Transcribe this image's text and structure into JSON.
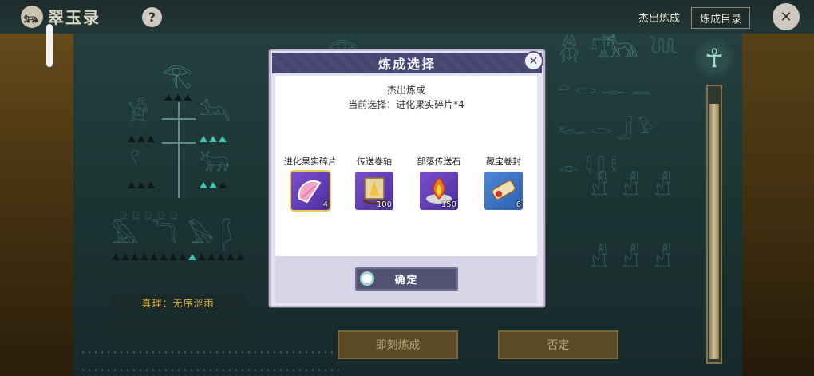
{
  "app": {
    "title": "翠玉录",
    "help_label": "?"
  },
  "top_links": {
    "outstanding": "杰出炼成",
    "catalog": "炼成目录"
  },
  "panel": {
    "truth_label": "真理：无序涩雨"
  },
  "actions": {
    "engrave": "即刻炼成",
    "deny": "否定"
  },
  "modal": {
    "title": "炼成选择",
    "subtitle": "杰出炼成",
    "current_selection": "当前选择：进化果实碎片*4",
    "confirm": "确定",
    "items": [
      {
        "name": "进化果实碎片",
        "count": "4",
        "icon": "fruit-shard-icon",
        "selected": true
      },
      {
        "name": "传送卷轴",
        "count": "100",
        "icon": "teleport-scroll-icon",
        "selected": false
      },
      {
        "name": "部落传送石",
        "count": "150",
        "icon": "tribe-teleport-stone-icon",
        "selected": false
      },
      {
        "name": "藏宝卷封",
        "count": "6",
        "icon": "treasure-scroll-icon",
        "selected": false
      }
    ]
  },
  "colors": {
    "modal_header": "#4a4a78",
    "confirm_button": "#525272",
    "truth_text": "#e0b846",
    "selected_border": "#f3c84a"
  }
}
